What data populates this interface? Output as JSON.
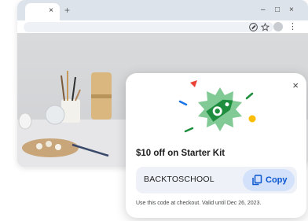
{
  "browser": {
    "tab": {
      "close_glyph": "×",
      "close_icon": "close-icon"
    },
    "new_tab_glyph": "+",
    "window_controls": {
      "minimize": "–",
      "maximize": "□",
      "close": "×"
    },
    "toolbar": {
      "icons": [
        "price-tag-icon",
        "star-icon",
        "avatar",
        "more-vert-icon"
      ],
      "kebab_glyph": "⋮"
    }
  },
  "popup": {
    "title": "$10 off on Starter Kit",
    "code": "BACKTOSCHOOL",
    "copy_label": "Copy",
    "note": "Use this code at checkout. Valid until Dec 26, 2023.",
    "close_glyph": "×",
    "colors": {
      "accent": "#0b57d0",
      "copy_bg": "#d3e1fb",
      "code_bg": "#eef2f8",
      "tag_green": "#1e8e3e",
      "burst_green": "#81c995",
      "dot_yellow": "#fbbc04",
      "triangle_red": "#ea4335",
      "dash_blue": "#1a73e8"
    }
  }
}
